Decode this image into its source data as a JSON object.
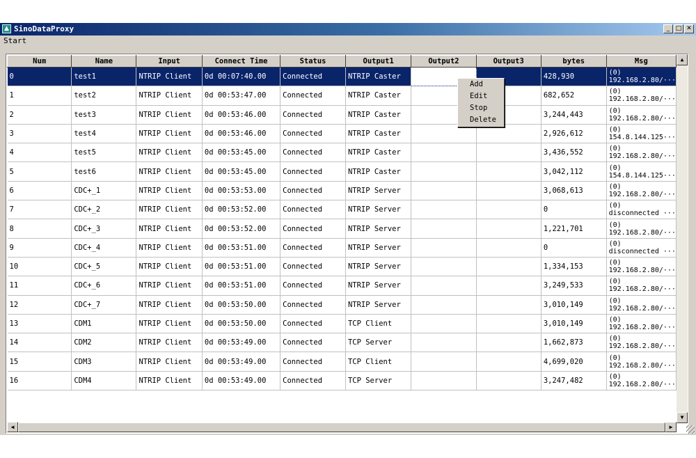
{
  "window": {
    "title": "SinoDataProxy"
  },
  "menu": {
    "start": "Start"
  },
  "columns": [
    "Num",
    "Name",
    "Input",
    "Connect Time",
    "Status",
    "Output1",
    "Output2",
    "Output3",
    "bytes",
    "Msg"
  ],
  "rows": [
    {
      "num": "0",
      "name": "test1",
      "input": "NTRIP Client",
      "time": "0d 00:07:40.00",
      "status": "Connected",
      "out1": "NTRIP Caster",
      "out2": "",
      "out3": "",
      "bytes": "428,930",
      "msg": "(0)\n192.168.2.80/···"
    },
    {
      "num": "1",
      "name": "test2",
      "input": "NTRIP Client",
      "time": "0d 00:53:47.00",
      "status": "Connected",
      "out1": "NTRIP Caster",
      "out2": "",
      "out3": "",
      "bytes": "682,652",
      "msg": "(0)\n192.168.2.80/···"
    },
    {
      "num": "2",
      "name": "test3",
      "input": "NTRIP Client",
      "time": "0d 00:53:46.00",
      "status": "Connected",
      "out1": "NTRIP Caster",
      "out2": "",
      "out3": "",
      "bytes": "3,244,443",
      "msg": "(0)\n192.168.2.80/···"
    },
    {
      "num": "3",
      "name": "test4",
      "input": "NTRIP Client",
      "time": "0d 00:53:46.00",
      "status": "Connected",
      "out1": "NTRIP Caster",
      "out2": "",
      "out3": "",
      "bytes": "2,926,612",
      "msg": "(0)\n154.8.144.125···"
    },
    {
      "num": "4",
      "name": "test5",
      "input": "NTRIP Client",
      "time": "0d 00:53:45.00",
      "status": "Connected",
      "out1": "NTRIP Caster",
      "out2": "",
      "out3": "",
      "bytes": "3,436,552",
      "msg": "(0)\n192.168.2.80/···"
    },
    {
      "num": "5",
      "name": "test6",
      "input": "NTRIP Client",
      "time": "0d 00:53:45.00",
      "status": "Connected",
      "out1": "NTRIP Caster",
      "out2": "",
      "out3": "",
      "bytes": "3,042,112",
      "msg": "(0)\n154.8.144.125···"
    },
    {
      "num": "6",
      "name": "CDC+_1",
      "input": "NTRIP Client",
      "time": "0d 00:53:53.00",
      "status": "Connected",
      "out1": "NTRIP Server",
      "out2": "",
      "out3": "",
      "bytes": "3,068,613",
      "msg": "(0)\n192.168.2.80/···"
    },
    {
      "num": "7",
      "name": "CDC+_2",
      "input": "NTRIP Client",
      "time": "0d 00:53:52.00",
      "status": "Connected",
      "out1": "NTRIP Server",
      "out2": "",
      "out3": "",
      "bytes": "0",
      "msg": "(0)\ndisconnected ···"
    },
    {
      "num": "8",
      "name": "CDC+_3",
      "input": "NTRIP Client",
      "time": "0d 00:53:52.00",
      "status": "Connected",
      "out1": "NTRIP Server",
      "out2": "",
      "out3": "",
      "bytes": "1,221,701",
      "msg": "(0)\n192.168.2.80/···"
    },
    {
      "num": "9",
      "name": "CDC+_4",
      "input": "NTRIP Client",
      "time": "0d 00:53:51.00",
      "status": "Connected",
      "out1": "NTRIP Server",
      "out2": "",
      "out3": "",
      "bytes": "0",
      "msg": "(0)\ndisconnected ···"
    },
    {
      "num": "10",
      "name": "CDC+_5",
      "input": "NTRIP Client",
      "time": "0d 00:53:51.00",
      "status": "Connected",
      "out1": "NTRIP Server",
      "out2": "",
      "out3": "",
      "bytes": "1,334,153",
      "msg": "(0)\n192.168.2.80/···"
    },
    {
      "num": "11",
      "name": "CDC+_6",
      "input": "NTRIP Client",
      "time": "0d 00:53:51.00",
      "status": "Connected",
      "out1": "NTRIP Server",
      "out2": "",
      "out3": "",
      "bytes": "3,249,533",
      "msg": "(0)\n192.168.2.80/···"
    },
    {
      "num": "12",
      "name": "CDC+_7",
      "input": "NTRIP Client",
      "time": "0d 00:53:50.00",
      "status": "Connected",
      "out1": "NTRIP Server",
      "out2": "",
      "out3": "",
      "bytes": "3,010,149",
      "msg": "(0)\n192.168.2.80/···"
    },
    {
      "num": "13",
      "name": "CDM1",
      "input": "NTRIP Client",
      "time": "0d 00:53:50.00",
      "status": "Connected",
      "out1": "TCP Client",
      "out2": "",
      "out3": "",
      "bytes": "3,010,149",
      "msg": "(0)\n192.168.2.80/···"
    },
    {
      "num": "14",
      "name": "CDM2",
      "input": "NTRIP Client",
      "time": "0d 00:53:49.00",
      "status": "Connected",
      "out1": "TCP Server",
      "out2": "",
      "out3": "",
      "bytes": "1,662,873",
      "msg": "(0)\n192.168.2.80/···"
    },
    {
      "num": "15",
      "name": "CDM3",
      "input": "NTRIP Client",
      "time": "0d 00:53:49.00",
      "status": "Connected",
      "out1": "TCP Client",
      "out2": "",
      "out3": "",
      "bytes": "4,699,020",
      "msg": "(0)\n192.168.2.80/···"
    },
    {
      "num": "16",
      "name": "CDM4",
      "input": "NTRIP Client",
      "time": "0d 00:53:49.00",
      "status": "Connected",
      "out1": "TCP Server",
      "out2": "",
      "out3": "",
      "bytes": "3,247,482",
      "msg": "(0)\n192.168.2.80/···"
    }
  ],
  "context_menu": {
    "items": [
      "Add",
      "Edit",
      "Stop",
      "Delete"
    ]
  },
  "icons": {
    "app": "app-icon",
    "minimize": "minimize-icon",
    "maximize": "maximize-icon",
    "close": "close-icon"
  },
  "colors": {
    "title_start": "#0a246a",
    "selection": "#0a246a",
    "face": "#d4d0c8"
  }
}
